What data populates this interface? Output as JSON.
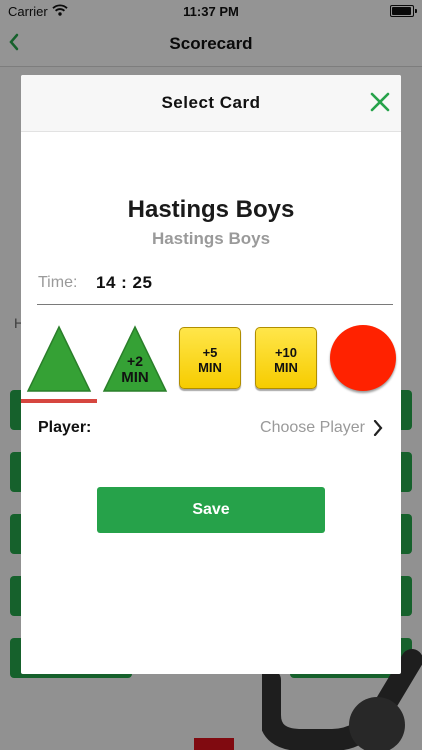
{
  "status_bar": {
    "carrier": "Carrier",
    "time": "11:37 PM"
  },
  "nav": {
    "title": "Scorecard",
    "back_icon": "chevron-left-icon"
  },
  "background": {
    "partial_letter": "H"
  },
  "modal": {
    "title": "Select Card",
    "close_icon": "close-x-icon",
    "team_name": "Hastings Boys",
    "team_subtitle": "Hastings Boys",
    "time_label": "Time:",
    "time_value": "14 : 25",
    "cards": [
      {
        "type": "green-triangle",
        "label": "",
        "selected": true
      },
      {
        "type": "green-triangle",
        "label_top": "+2",
        "label_bottom": "MIN"
      },
      {
        "type": "yellow",
        "label_top": "+5",
        "label_bottom": "MIN"
      },
      {
        "type": "yellow",
        "label_top": "+10",
        "label_bottom": "MIN"
      },
      {
        "type": "red-circle",
        "label": ""
      }
    ],
    "player_label": "Player:",
    "player_value": "Choose Player",
    "save_label": "Save"
  },
  "colors": {
    "accent_green": "#26a24a",
    "selected_underline": "#d6463f",
    "yellow_card": "#f6cc00",
    "red_card": "#ff2200"
  }
}
